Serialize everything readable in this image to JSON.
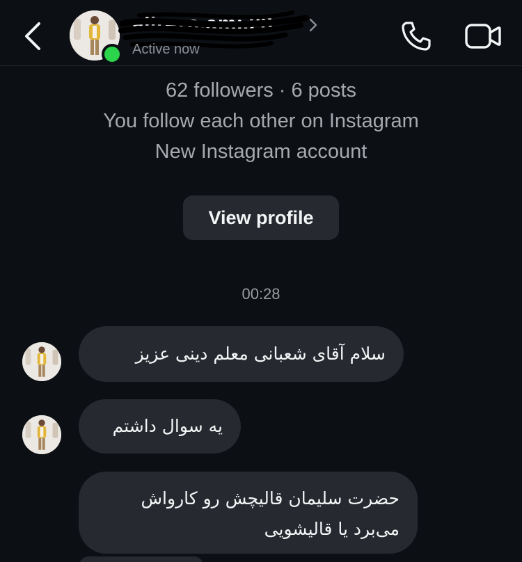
{
  "header": {
    "username": "alireza.ami.23",
    "status": "Active now",
    "back_icon": "chevron-left-icon",
    "profile_chevron_icon": "chevron-right-icon",
    "call_icon": "phone-icon",
    "video_icon": "video-camera-icon",
    "online_color": "#2bd44a"
  },
  "profile": {
    "followers_line": "62 followers · 6 posts",
    "follow_line": "You follow each other on Instagram",
    "account_line": "New Instagram account",
    "view_profile_label": "View profile"
  },
  "chat": {
    "timestamp": "00:28",
    "messages": [
      {
        "text": "سلام آقای شعبانی معلم دینی عزیز"
      },
      {
        "text": "یه سوال داشتم"
      },
      {
        "line1": "حضرت سلیمان قالیچش رو کارواش",
        "line2": "می‌برد یا قالیشویی"
      }
    ]
  },
  "colors": {
    "background": "#0c0f14",
    "bubble": "#26292f",
    "button": "#262a30",
    "secondary_text": "#a6a9ae"
  }
}
